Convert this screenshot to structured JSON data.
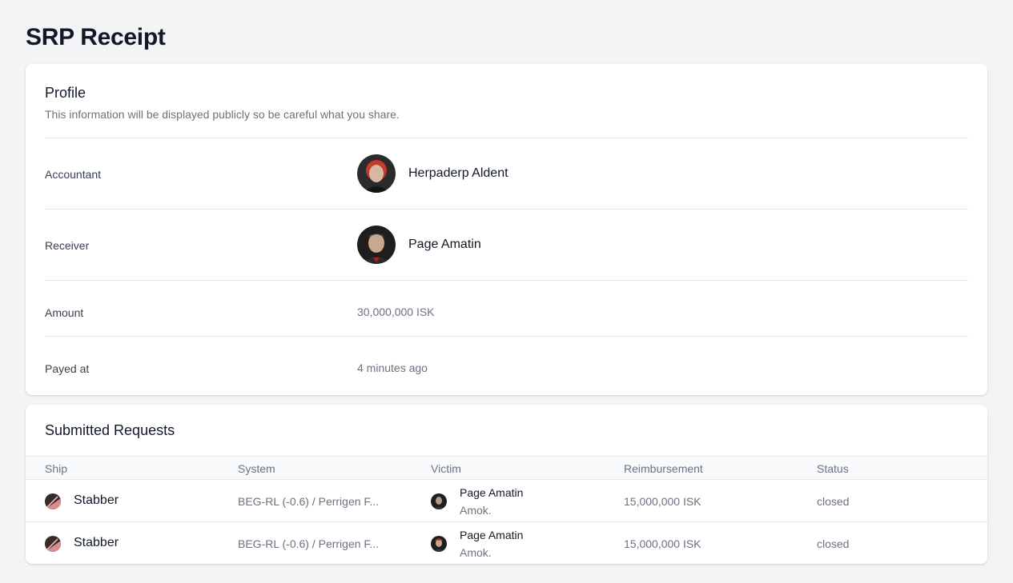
{
  "page": {
    "title": "SRP Receipt"
  },
  "profile": {
    "heading": "Profile",
    "subheading": "This information will be displayed publicly so be careful what you share.",
    "fields": {
      "accountant": {
        "label": "Accountant",
        "name": "Herpaderp Aldent",
        "avatar_icon": "character-portrait-icon"
      },
      "receiver": {
        "label": "Receiver",
        "name": "Page Amatin",
        "avatar_icon": "character-portrait-icon"
      },
      "amount": {
        "label": "Amount",
        "value": "30,000,000 ISK"
      },
      "payed_at": {
        "label": "Payed at",
        "value": "4 minutes ago"
      }
    }
  },
  "requests": {
    "heading": "Submitted Requests",
    "columns": [
      "Ship",
      "System",
      "Victim",
      "Reimbursement",
      "Status"
    ],
    "rows": [
      {
        "ship": "Stabber",
        "ship_icon": "ship-icon",
        "system": "BEG-RL (-0.6) / Perrigen F...",
        "victim": "Page Amatin",
        "victim_corp": "Amok.",
        "reimbursement": "15,000,000 ISK",
        "status": "closed"
      },
      {
        "ship": "Stabber",
        "ship_icon": "ship-icon",
        "system": "BEG-RL (-0.6) / Perrigen F...",
        "victim": "Page Amatin",
        "victim_corp": "Amok.",
        "reimbursement": "15,000,000 ISK",
        "status": "closed"
      }
    ]
  },
  "colors": {
    "background": "#f3f4f6",
    "card": "#ffffff",
    "text": "#111827",
    "muted": "#6b7280",
    "border": "#e5e7eb"
  }
}
